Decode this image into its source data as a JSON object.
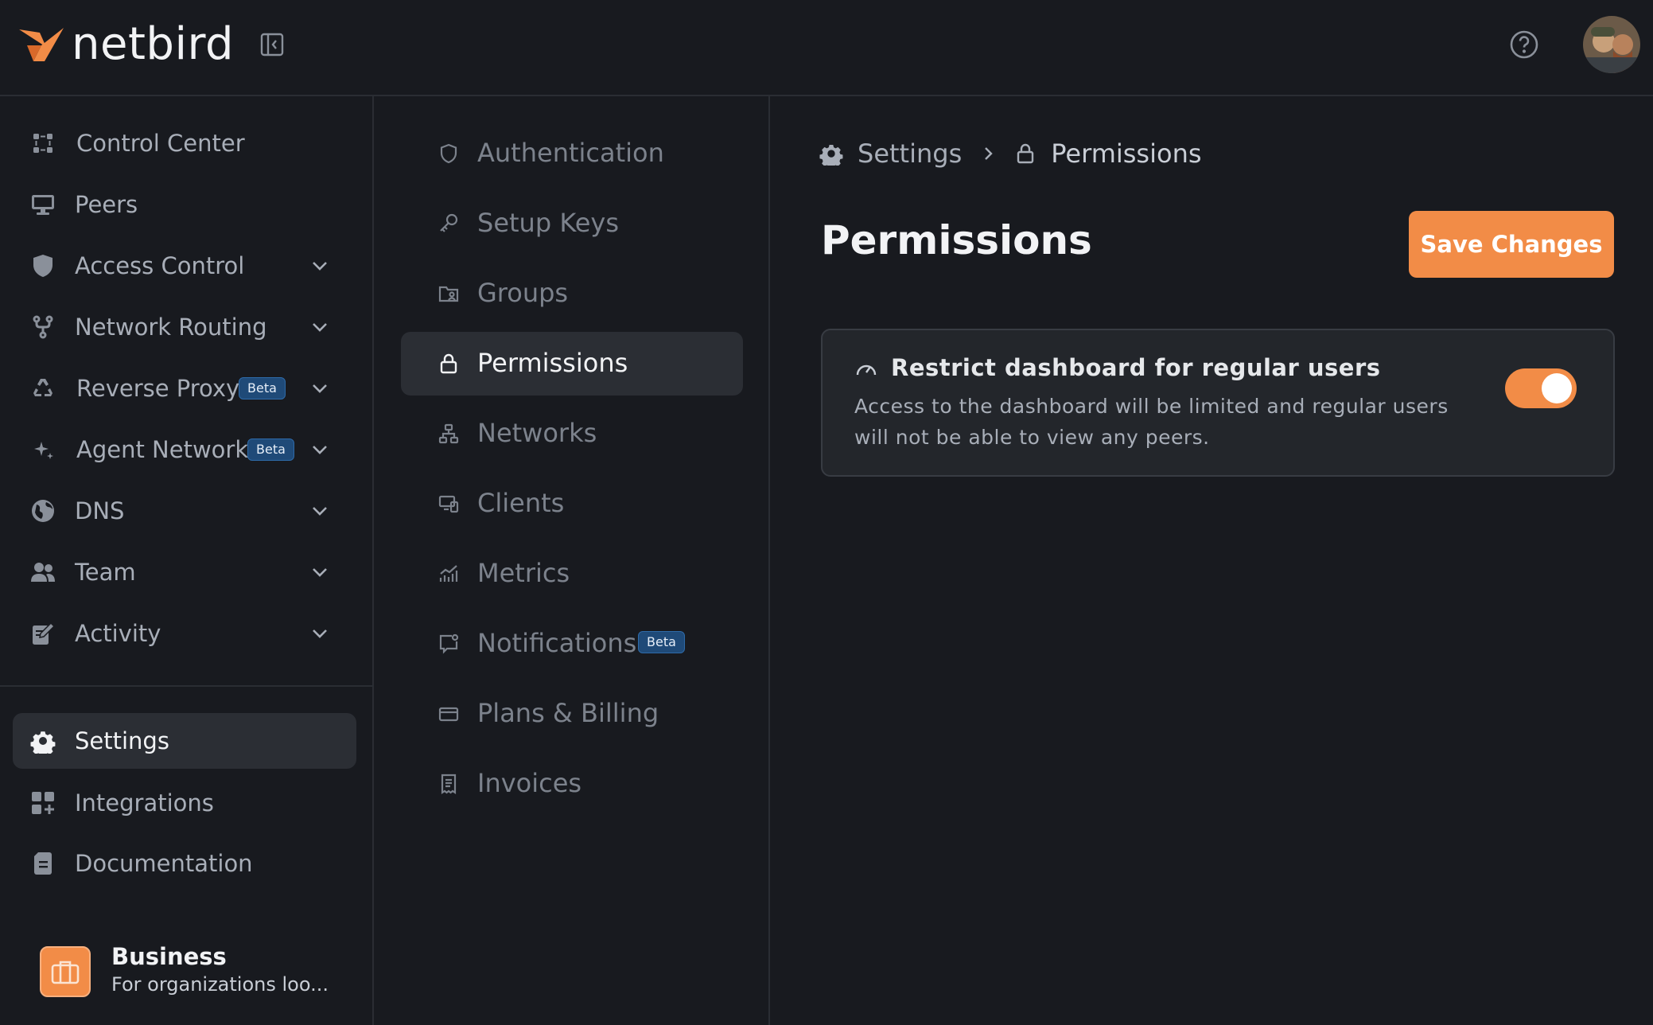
{
  "brand": {
    "name": "netbird",
    "accent": "#f28c47"
  },
  "topbar": {
    "collapse_icon": "sidebar-collapse-icon",
    "help_icon": "help-circle-icon"
  },
  "sidebar": {
    "items": [
      {
        "label": "Control Center",
        "icon": "control-center-icon"
      },
      {
        "label": "Peers",
        "icon": "monitor-icon"
      },
      {
        "label": "Access Control",
        "icon": "shield-icon"
      },
      {
        "label": "Network Routing",
        "icon": "git-fork-icon"
      },
      {
        "label": "Reverse Proxy",
        "icon": "recycle-icon",
        "badge": "Beta"
      },
      {
        "label": "Agent Network",
        "icon": "sparkle-icon",
        "badge": "Beta"
      },
      {
        "label": "DNS",
        "icon": "globe-icon"
      },
      {
        "label": "Team",
        "icon": "users-icon"
      },
      {
        "label": "Activity",
        "icon": "edit-icon"
      }
    ],
    "bottom": [
      {
        "label": "Settings",
        "icon": "gear-icon"
      },
      {
        "label": "Integrations",
        "icon": "grid-plus-icon"
      },
      {
        "label": "Documentation",
        "icon": "document-icon"
      }
    ],
    "plan": {
      "title": "Business",
      "subtitle": "For organizations loo..."
    }
  },
  "subnav": {
    "items": [
      {
        "label": "Authentication"
      },
      {
        "label": "Setup Keys"
      },
      {
        "label": "Groups"
      },
      {
        "label": "Permissions"
      },
      {
        "label": "Networks"
      },
      {
        "label": "Clients"
      },
      {
        "label": "Metrics"
      },
      {
        "label": "Notifications",
        "badge": "Beta"
      },
      {
        "label": "Plans & Billing"
      },
      {
        "label": "Invoices"
      }
    ]
  },
  "main": {
    "breadcrumb": {
      "root": "Settings",
      "current": "Permissions"
    },
    "title": "Permissions",
    "save_label": "Save Changes",
    "setting": {
      "title": "Restrict dashboard for regular users",
      "description": "Access to the dashboard will be limited and regular users will not be able to view any peers.",
      "enabled": true
    }
  }
}
